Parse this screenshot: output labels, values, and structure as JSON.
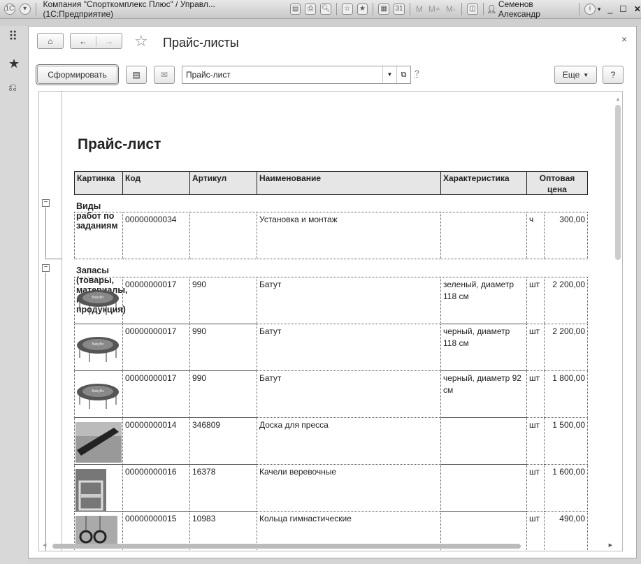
{
  "window": {
    "title": "Компания \"Спорткомплекс Плюс\" / Управл... (1С:Предприятие)",
    "user": "Семенов Александр",
    "mem": [
      "M",
      "M+",
      "M-"
    ]
  },
  "nav": {
    "page_title": "Прайс-листы",
    "close": "×"
  },
  "toolbar": {
    "generate": "Сформировать",
    "report_variant": "Прайс-лист",
    "help_link": "?",
    "more": "Еще",
    "help": "?"
  },
  "report": {
    "title": "Прайс-лист",
    "columns": [
      "Картинка",
      "Код",
      "Артикул",
      "Наименование",
      "Характеристика",
      "Оптовая цена"
    ],
    "groups": [
      {
        "name": "Виды работ по заданиям",
        "rows": [
          {
            "image": "",
            "code": "00000000034",
            "article": "",
            "name": "Установка и монтаж",
            "characteristic": "",
            "unit": "ч",
            "price": "300,00"
          }
        ]
      },
      {
        "name": "Запасы (товары, материалы, готовая продукция)",
        "rows": [
          {
            "image": "trampoline",
            "code": "00000000017",
            "article": "990",
            "name": "Батут",
            "characteristic": "зеленый, диаметр 118 см",
            "unit": "шт",
            "price": "2 200,00"
          },
          {
            "image": "trampoline",
            "code": "00000000017",
            "article": "990",
            "name": "Батут",
            "characteristic": "черный, диаметр 118 см",
            "unit": "шт",
            "price": "2 200,00"
          },
          {
            "image": "trampoline",
            "code": "00000000017",
            "article": "990",
            "name": "Батут",
            "characteristic": "черный, диаметр 92 см",
            "unit": "шт",
            "price": "1 800,00"
          },
          {
            "image": "board",
            "code": "00000000014",
            "article": "346809",
            "name": "Доска для пресса",
            "characteristic": "",
            "unit": "шт",
            "price": "1 500,00"
          },
          {
            "image": "swing",
            "code": "00000000016",
            "article": "16378",
            "name": "Качели веревочные",
            "characteristic": "",
            "unit": "шт",
            "price": "1 600,00"
          },
          {
            "image": "rings",
            "code": "00000000015",
            "article": "10983",
            "name": "Кольца гимнастические",
            "characteristic": "",
            "unit": "шт",
            "price": "490,00"
          }
        ]
      }
    ]
  }
}
